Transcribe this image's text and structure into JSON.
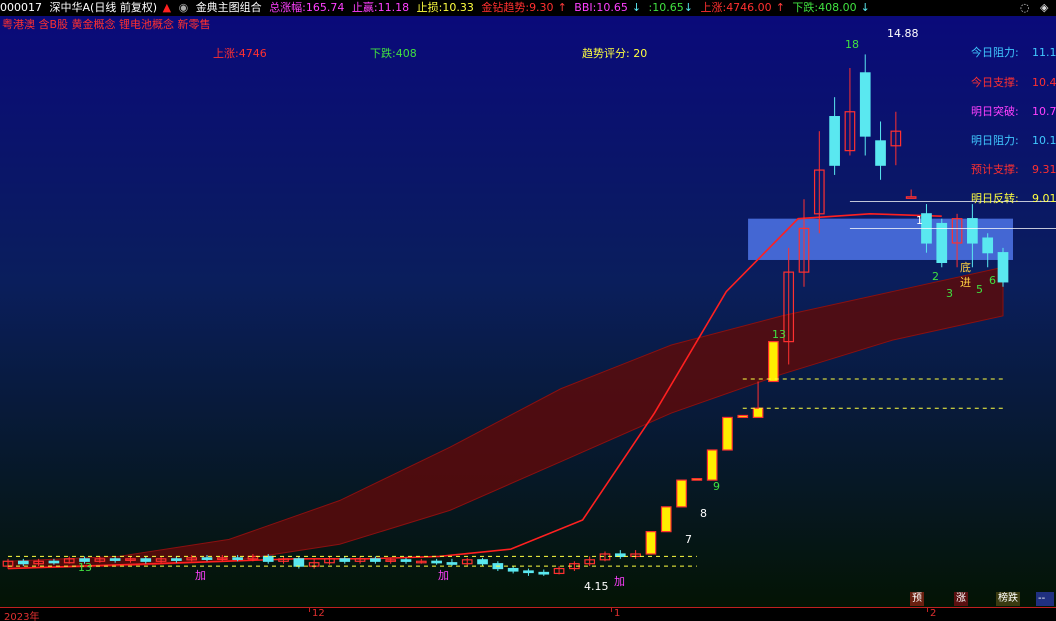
{
  "header": {
    "code": "000017",
    "name": "深中华A(日线 前复权)",
    "indicator": "金典主图组合",
    "total_label": "总涨幅:",
    "total_value": "165.74",
    "stop_profit_label": "止赢:",
    "stop_profit_value": "11.18",
    "stop_loss_label": "止损:",
    "stop_loss_value": "10.33",
    "trend_label": "金钻趋势:",
    "trend_value": "9.30",
    "bbi_label": "BBI:",
    "bbi_value": "10.65",
    "extra_value": ":10.65",
    "up_label": "上涨:",
    "up_value": "4746.00",
    "down_label": "下跌:",
    "down_value": "408.00"
  },
  "concepts": "粤港澳 含B股 黄金概念 锂电池概念 新零售",
  "stats": {
    "up": "上涨:4746",
    "down": "下跌:408",
    "score": "趋势评分: 20"
  },
  "levels": [
    {
      "label": "今日阻力:",
      "value": "11.1",
      "color": "#40c8ff"
    },
    {
      "label": "今日支撑:",
      "value": "10.4",
      "color": "#ff3030"
    },
    {
      "label": "明日突破:",
      "value": "10.7",
      "color": "#ff40ff"
    },
    {
      "label": "明日阻力:",
      "value": "10.1",
      "color": "#40c8ff"
    },
    {
      "label": "预计支撑:",
      "value": "9.31",
      "color": "#ff3030"
    },
    {
      "label": "明日反转:",
      "value": "9.01",
      "color": "#ffff40"
    }
  ],
  "annotations": {
    "high": "14.88",
    "low": "4.15",
    "di": "底",
    "jin": "进",
    "jia": "加"
  },
  "xaxis": {
    "year": "2023年",
    "m12": "12",
    "m1": "1",
    "m2": "2"
  },
  "buttons": {
    "yu": "预",
    "zhang": "涨",
    "bang": "榜跌"
  },
  "colors": {
    "up": "#ff3030",
    "down": "#5ae8f0",
    "limit": "#ffee00"
  },
  "chart_data": {
    "type": "candlestick",
    "title": "深中华A(日线 前复权)",
    "ylim": [
      3.9,
      15.3
    ],
    "candles": [
      {
        "o": 4.35,
        "c": 4.45,
        "h": 4.5,
        "l": 4.3
      },
      {
        "o": 4.45,
        "c": 4.4,
        "h": 4.5,
        "l": 4.35
      },
      {
        "o": 4.4,
        "c": 4.45,
        "h": 4.5,
        "l": 4.35
      },
      {
        "o": 4.45,
        "c": 4.42,
        "h": 4.5,
        "l": 4.38
      },
      {
        "o": 4.42,
        "c": 4.5,
        "h": 4.55,
        "l": 4.4
      },
      {
        "o": 4.5,
        "c": 4.45,
        "h": 4.55,
        "l": 4.4
      },
      {
        "o": 4.45,
        "c": 4.5,
        "h": 4.55,
        "l": 4.42
      },
      {
        "o": 4.5,
        "c": 4.48,
        "h": 4.55,
        "l": 4.42
      },
      {
        "o": 4.48,
        "c": 4.5,
        "h": 4.55,
        "l": 4.42
      },
      {
        "o": 4.5,
        "c": 4.45,
        "h": 4.55,
        "l": 4.4
      },
      {
        "o": 4.45,
        "c": 4.5,
        "h": 4.55,
        "l": 4.42
      },
      {
        "o": 4.5,
        "c": 4.48,
        "h": 4.55,
        "l": 4.42
      },
      {
        "o": 4.48,
        "c": 4.52,
        "h": 4.58,
        "l": 4.45
      },
      {
        "o": 4.52,
        "c": 4.5,
        "h": 4.58,
        "l": 4.45
      },
      {
        "o": 4.5,
        "c": 4.52,
        "h": 4.58,
        "l": 4.45
      },
      {
        "o": 4.52,
        "c": 4.5,
        "h": 4.58,
        "l": 4.45
      },
      {
        "o": 4.5,
        "c": 4.55,
        "h": 4.6,
        "l": 4.45
      },
      {
        "o": 4.55,
        "c": 4.45,
        "h": 4.6,
        "l": 4.4
      },
      {
        "o": 4.45,
        "c": 4.5,
        "h": 4.55,
        "l": 4.4
      },
      {
        "o": 4.5,
        "c": 4.35,
        "h": 4.55,
        "l": 4.3
      },
      {
        "o": 4.35,
        "c": 4.42,
        "h": 4.5,
        "l": 4.3
      },
      {
        "o": 4.42,
        "c": 4.5,
        "h": 4.55,
        "l": 4.38
      },
      {
        "o": 4.5,
        "c": 4.45,
        "h": 4.55,
        "l": 4.4
      },
      {
        "o": 4.45,
        "c": 4.5,
        "h": 4.55,
        "l": 4.4
      },
      {
        "o": 4.5,
        "c": 4.45,
        "h": 4.55,
        "l": 4.4
      },
      {
        "o": 4.45,
        "c": 4.48,
        "h": 4.52,
        "l": 4.4
      },
      {
        "o": 4.48,
        "c": 4.45,
        "h": 4.52,
        "l": 4.4
      },
      {
        "o": 4.45,
        "c": 4.45,
        "h": 4.5,
        "l": 4.4
      },
      {
        "o": 4.45,
        "c": 4.42,
        "h": 4.5,
        "l": 4.38
      },
      {
        "o": 4.42,
        "c": 4.4,
        "h": 4.5,
        "l": 4.35
      },
      {
        "o": 4.4,
        "c": 4.48,
        "h": 4.52,
        "l": 4.35
      },
      {
        "o": 4.48,
        "c": 4.4,
        "h": 4.52,
        "l": 4.35
      },
      {
        "o": 4.4,
        "c": 4.3,
        "h": 4.45,
        "l": 4.25
      },
      {
        "o": 4.3,
        "c": 4.25,
        "h": 4.35,
        "l": 4.2
      },
      {
        "o": 4.25,
        "c": 4.22,
        "h": 4.3,
        "l": 4.15
      },
      {
        "o": 4.22,
        "c": 4.2,
        "h": 4.28,
        "l": 4.15
      },
      {
        "o": 4.2,
        "c": 4.3,
        "h": 4.35,
        "l": 4.18
      },
      {
        "o": 4.3,
        "c": 4.4,
        "h": 4.45,
        "l": 4.25
      },
      {
        "o": 4.4,
        "c": 4.48,
        "h": 4.55,
        "l": 4.35
      },
      {
        "o": 4.48,
        "c": 4.6,
        "h": 4.65,
        "l": 4.45
      },
      {
        "o": 4.6,
        "c": 4.55,
        "h": 4.68,
        "l": 4.5
      },
      {
        "o": 4.55,
        "c": 4.6,
        "h": 4.68,
        "l": 4.5
      },
      {
        "o": 4.6,
        "c": 5.06,
        "h": 5.06,
        "l": 4.6
      },
      {
        "o": 5.06,
        "c": 5.57,
        "h": 5.57,
        "l": 5.06
      },
      {
        "o": 5.57,
        "c": 6.12,
        "h": 6.12,
        "l": 5.57
      },
      {
        "o": 6.12,
        "c": 6.15,
        "h": 6.15,
        "l": 6.12
      },
      {
        "o": 6.12,
        "c": 6.74,
        "h": 6.74,
        "l": 6.12
      },
      {
        "o": 6.74,
        "c": 7.41,
        "h": 7.41,
        "l": 6.74
      },
      {
        "o": 7.41,
        "c": 7.45,
        "h": 7.45,
        "l": 7.41
      },
      {
        "o": 7.41,
        "c": 7.6,
        "h": 8.15,
        "l": 7.41
      },
      {
        "o": 8.15,
        "c": 8.97,
        "h": 8.97,
        "l": 8.15
      },
      {
        "o": 8.97,
        "c": 10.4,
        "h": 10.9,
        "l": 8.5
      },
      {
        "o": 10.4,
        "c": 11.3,
        "h": 11.9,
        "l": 10.1
      },
      {
        "o": 11.6,
        "c": 12.5,
        "h": 13.3,
        "l": 11.2
      },
      {
        "o": 13.6,
        "c": 12.6,
        "h": 14.0,
        "l": 12.4
      },
      {
        "o": 12.9,
        "c": 13.7,
        "h": 14.6,
        "l": 12.8
      },
      {
        "o": 14.5,
        "c": 13.2,
        "h": 14.88,
        "l": 12.8
      },
      {
        "o": 13.1,
        "c": 12.6,
        "h": 13.5,
        "l": 12.3
      },
      {
        "o": 13.0,
        "c": 13.3,
        "h": 13.7,
        "l": 12.6
      },
      {
        "o": 11.95,
        "c": 11.95,
        "h": 12.1,
        "l": 11.95
      },
      {
        "o": 11.6,
        "c": 11.0,
        "h": 11.8,
        "l": 10.8
      },
      {
        "o": 11.4,
        "c": 10.6,
        "h": 11.5,
        "l": 10.5
      },
      {
        "o": 11.0,
        "c": 11.5,
        "h": 11.6,
        "l": 10.5
      },
      {
        "o": 11.5,
        "c": 11.0,
        "h": 11.8,
        "l": 10.5
      },
      {
        "o": 11.1,
        "c": 10.8,
        "h": 11.2,
        "l": 10.5
      },
      {
        "o": 10.8,
        "c": 10.2,
        "h": 10.9,
        "l": 10.1
      }
    ],
    "cloud": {
      "upper": [
        4.45,
        4.55,
        4.9,
        5.7,
        6.8,
        8.0,
        8.9,
        9.5,
        10.0,
        10.5
      ],
      "lower": [
        4.3,
        4.35,
        4.45,
        4.8,
        5.5,
        6.5,
        7.5,
        8.3,
        9.0,
        9.5
      ]
    },
    "red_line": [
      4.3,
      4.35,
      4.4,
      4.45,
      4.5,
      4.5,
      4.55,
      4.7,
      5.3,
      7.5,
      10.0,
      11.5,
      11.6,
      11.55
    ],
    "band_box": {
      "top": 11.5,
      "bottom": 10.65
    },
    "number_labels": [
      "13",
      "18",
      "2",
      "3",
      "5",
      "6",
      "7",
      "8",
      "9",
      "13",
      "1"
    ]
  }
}
